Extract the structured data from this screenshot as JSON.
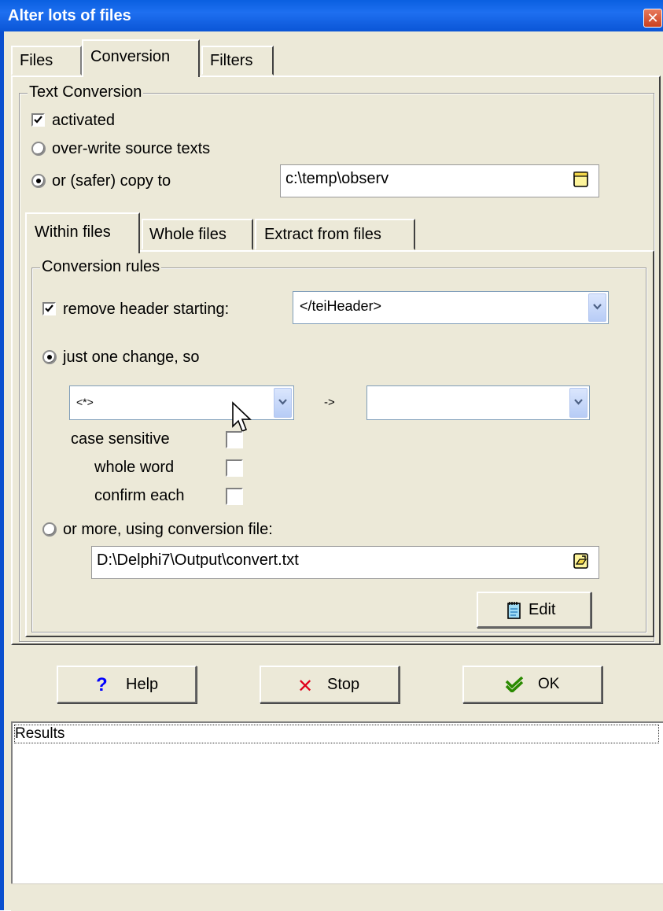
{
  "window": {
    "title": "Alter lots of files",
    "close_glyph": "✕"
  },
  "main_tabs": [
    {
      "label": "Files"
    },
    {
      "label": "Conversion"
    },
    {
      "label": "Filters"
    }
  ],
  "text_conversion": {
    "legend": "Text Conversion",
    "activated_label": "activated",
    "activated_checked": true,
    "overwrite_label": "over-write source texts",
    "copy_label": "or (safer) copy to",
    "selected_option": "copy",
    "copy_path": "c:\\temp\\observ"
  },
  "sub_tabs": [
    {
      "label": "Within files"
    },
    {
      "label": "Whole files"
    },
    {
      "label": "Extract from files"
    }
  ],
  "conversion_rules": {
    "legend": "Conversion rules",
    "remove_header_label": "remove header starting:",
    "remove_header_checked": true,
    "remove_header_value": "</teiHeader>",
    "one_change_label": "just one change, so",
    "selected_option": "one_change",
    "from_value": "<*>",
    "arrow_text": "->",
    "to_value": "",
    "case_sensitive_label": "case sensitive",
    "whole_word_label": "whole word",
    "confirm_each_label": "confirm each",
    "case_sensitive_checked": false,
    "whole_word_checked": false,
    "confirm_each_checked": false,
    "more_label": "or more, using conversion file:",
    "conversion_file": "D:\\Delphi7\\Output\\convert.txt",
    "edit_button": "Edit"
  },
  "buttons": {
    "help": "Help",
    "help_glyph": "?",
    "stop": "Stop",
    "stop_glyph": "✕",
    "ok": "OK"
  },
  "results": {
    "label": "Results"
  },
  "colors": {
    "title_bar": "#0a5fe0",
    "window_bg": "#ece9d8",
    "help_icon": "#0000ff",
    "stop_icon": "#e0001b",
    "ok_icon": "#2a8a00"
  }
}
